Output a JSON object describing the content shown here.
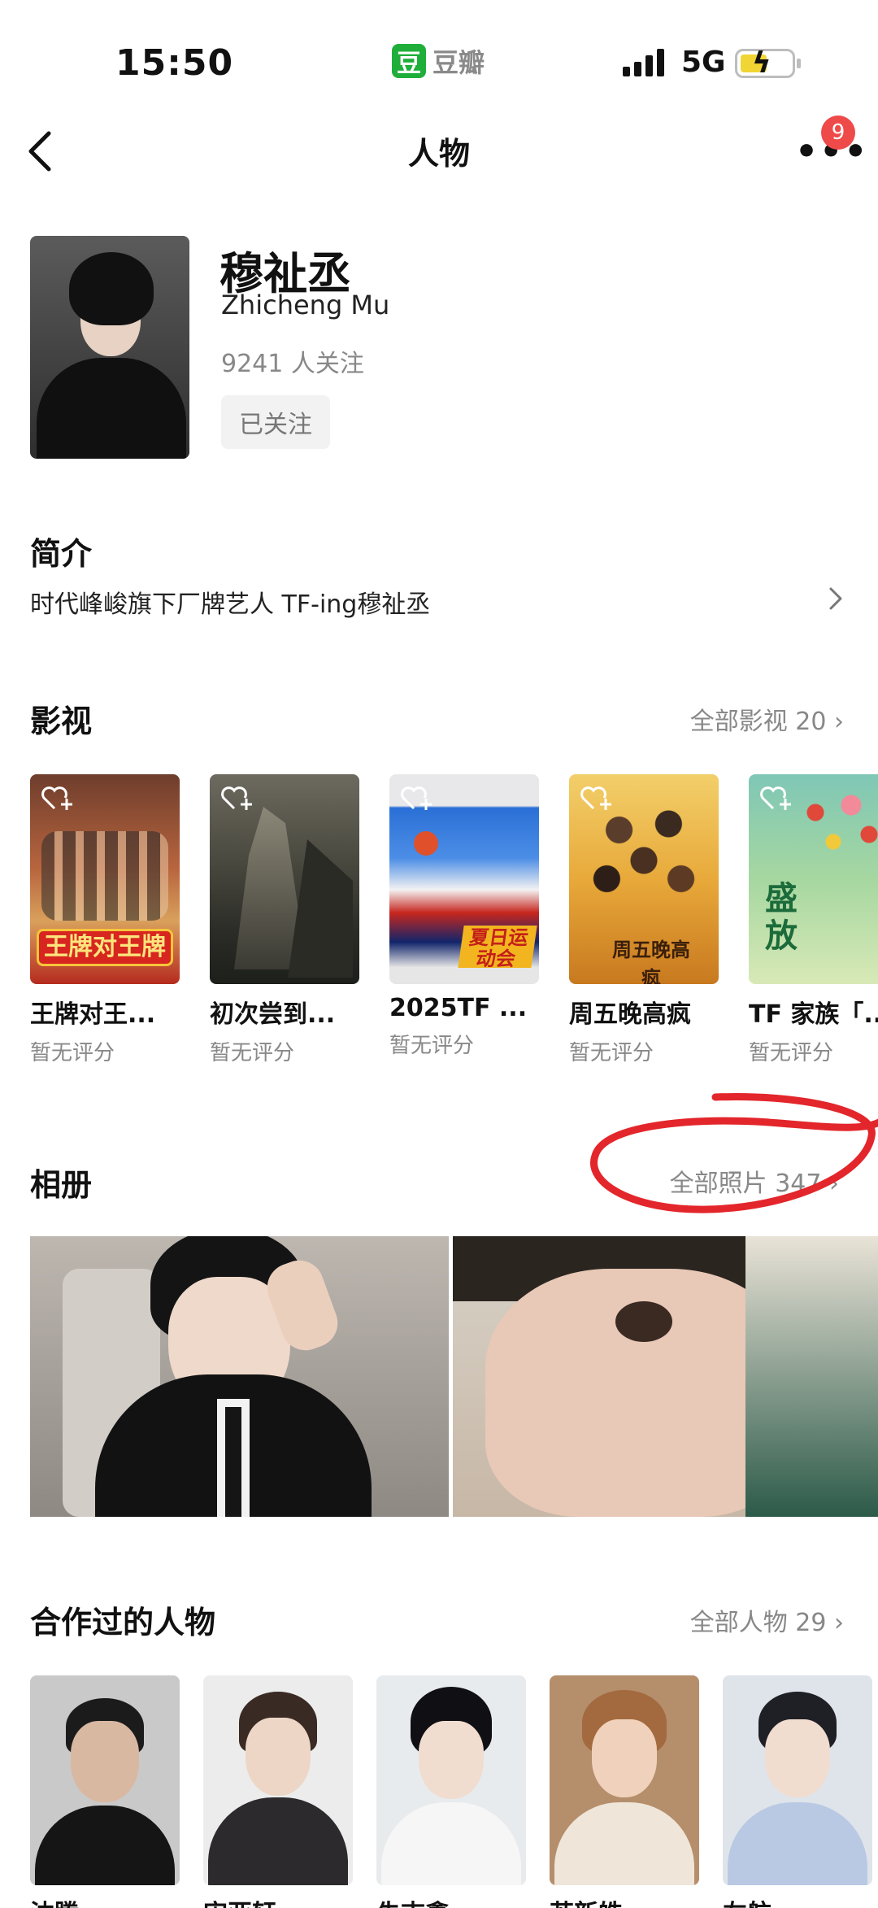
{
  "status_bar": {
    "time": "15:50",
    "app_badge": "豆",
    "app_name": "豆瓣",
    "network": "5G"
  },
  "nav": {
    "title": "人物",
    "notification_count": "9"
  },
  "profile": {
    "name": "穆祉丞",
    "english_name": "Zhicheng Mu",
    "followers": "9241 人关注",
    "follow_button": "已关注"
  },
  "intro": {
    "title": "简介",
    "text": "时代峰峻旗下厂牌艺人 TF-ing穆祉丞"
  },
  "works": {
    "title": "影视",
    "link": "全部影视 20",
    "items": [
      {
        "title": "王牌对王...",
        "rating": "暂无评分",
        "poster_text": "王牌对王牌"
      },
      {
        "title": "初次尝到...",
        "rating": "暂无评分",
        "poster_text": ""
      },
      {
        "title": "2025TF ...",
        "rating": "暂无评分",
        "poster_text": "夏日运动会"
      },
      {
        "title": "周五晚高疯",
        "rating": "暂无评分",
        "poster_text": "周五晚高疯"
      },
      {
        "title": "TF 家族「...",
        "rating": "暂无评分",
        "poster_text": "盛放"
      }
    ]
  },
  "album": {
    "title": "相册",
    "link": "全部照片 347"
  },
  "collaborators": {
    "title": "合作过的人物",
    "link": "全部人物 29",
    "items": [
      {
        "name": "沈腾"
      },
      {
        "name": "宋亚轩"
      },
      {
        "name": "朱志鑫"
      },
      {
        "name": "苏新皓"
      },
      {
        "name": "左航"
      }
    ]
  },
  "colors": {
    "accent_green": "#1fae3a",
    "badge_red": "#ef4a4a",
    "annotation_red": "#e3262b",
    "muted_text": "#888888"
  }
}
